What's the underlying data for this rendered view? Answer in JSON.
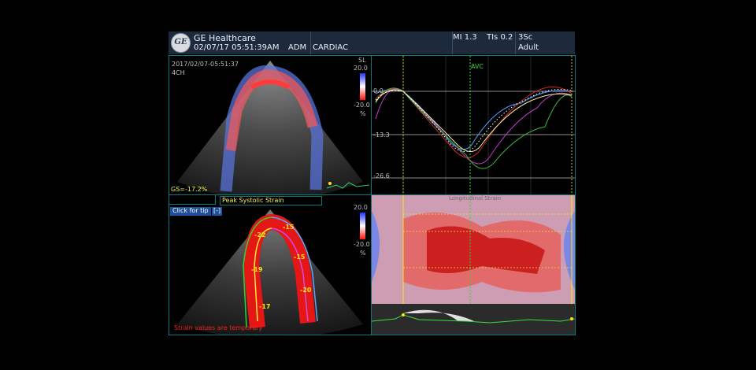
{
  "header": {
    "brand": "GE Healthcare",
    "datetime": "02/07/17 05:51:39AM",
    "operator": "ADM",
    "exam": "CARDIAC",
    "mi": "MI 1.3",
    "tis": "TIs 0.2",
    "probe": "3Sc",
    "patient_type": "Adult",
    "logo_text": "GE"
  },
  "top_left": {
    "timestamp": "2017/02/07-05:51:37",
    "view": "4CH",
    "gs_label": "GS=-17.2%",
    "scale_title": "SL",
    "scale_max": "20.0",
    "scale_min": "-20.0",
    "scale_unit": "%"
  },
  "bottom_left": {
    "title": "Peak Systolic Strain",
    "tip_button": "Click for tip",
    "tip_icon": "[-]",
    "scale_max": "20.0",
    "scale_min": "-20.0",
    "scale_unit": "%",
    "warning": "Strain values are temporary",
    "segment_values": [
      "-22",
      "-15",
      "-19",
      "-15",
      "-17",
      "-20"
    ]
  },
  "curves": {
    "event_label": "AVC",
    "y_ticks": [
      "0.0",
      "-13.3",
      "-26.6"
    ]
  },
  "mmode": {
    "title": "Longitudinal Strain"
  },
  "colors": {
    "header_bg": "#1c2a3c",
    "panel_border": "#0d7a7a",
    "label_yellow": "#f3f34a",
    "warning_red": "#ff2020",
    "avc_green": "#2ddc2d"
  }
}
